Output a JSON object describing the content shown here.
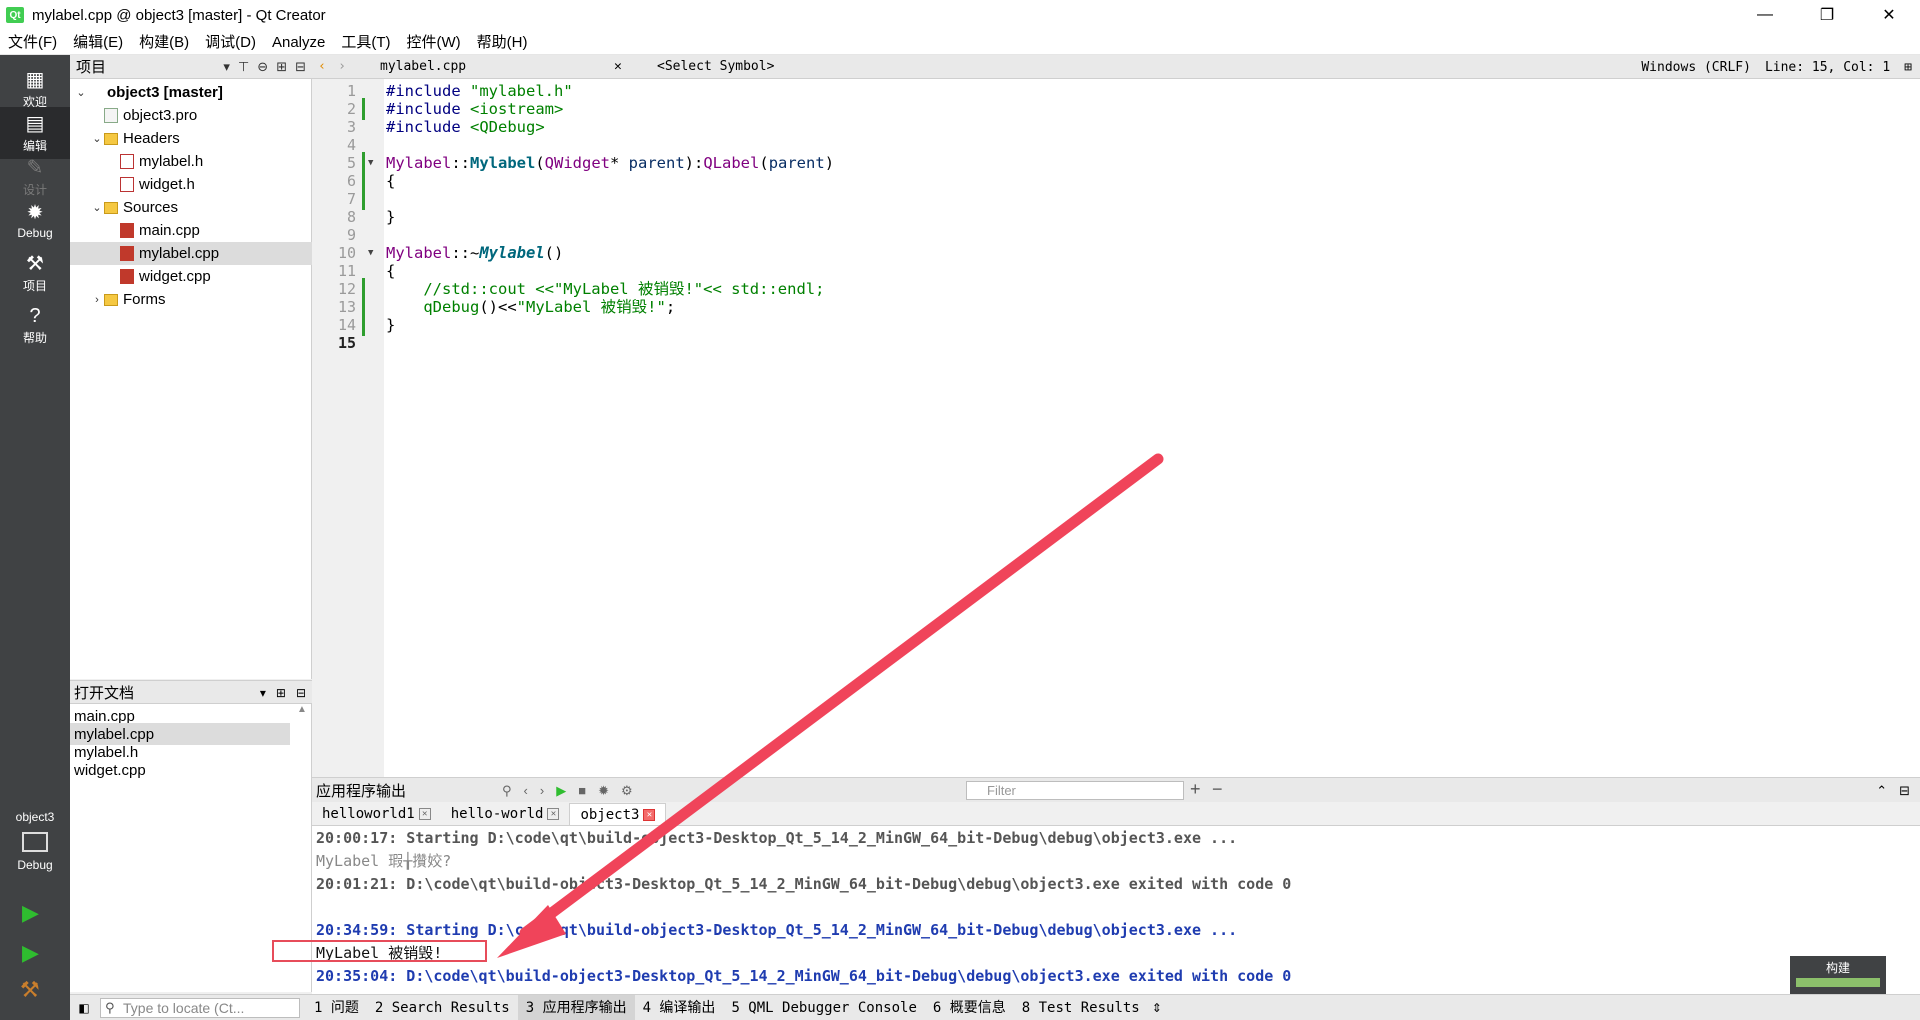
{
  "window": {
    "title": "mylabel.cpp @ object3 [master] - Qt Creator",
    "logo_text": "Qt",
    "minimize": "—",
    "maximize": "❐",
    "close": "✕"
  },
  "menu": [
    "文件(F)",
    "编辑(E)",
    "构建(B)",
    "调试(D)",
    "Analyze",
    "工具(T)",
    "控件(W)",
    "帮助(H)"
  ],
  "modes": [
    {
      "label": "欢迎",
      "icon": "grid-icon"
    },
    {
      "label": "编辑",
      "icon": "edit-icon"
    },
    {
      "label": "设计",
      "icon": "pencil-icon"
    },
    {
      "label": "Debug",
      "icon": "bug-icon"
    },
    {
      "label": "项目",
      "icon": "wrench-icon"
    },
    {
      "label": "帮助",
      "icon": "help-icon"
    }
  ],
  "kit": {
    "name": "object3",
    "mode": "Debug"
  },
  "project_panel": {
    "title": "项目",
    "tree": [
      {
        "label": "object3 [master]",
        "level": 0,
        "arrow": "open",
        "icon": "project",
        "bold": true
      },
      {
        "label": "object3.pro",
        "level": 1,
        "arrow": "",
        "icon": "pro"
      },
      {
        "label": "Headers",
        "level": 1,
        "arrow": "open",
        "icon": "folder"
      },
      {
        "label": "mylabel.h",
        "level": 2,
        "arrow": "",
        "icon": "header"
      },
      {
        "label": "widget.h",
        "level": 2,
        "arrow": "",
        "icon": "header"
      },
      {
        "label": "Sources",
        "level": 1,
        "arrow": "open",
        "icon": "folder"
      },
      {
        "label": "main.cpp",
        "level": 2,
        "arrow": "",
        "icon": "cpp"
      },
      {
        "label": "mylabel.cpp",
        "level": 2,
        "arrow": "",
        "icon": "cpp",
        "selected": true
      },
      {
        "label": "widget.cpp",
        "level": 2,
        "arrow": "",
        "icon": "cpp"
      },
      {
        "label": "Forms",
        "level": 1,
        "arrow": "closed",
        "icon": "folder"
      }
    ]
  },
  "open_documents": {
    "title": "打开文档",
    "items": [
      {
        "label": "main.cpp"
      },
      {
        "label": "mylabel.cpp",
        "selected": true
      },
      {
        "label": "mylabel.h"
      },
      {
        "label": "widget.cpp"
      }
    ]
  },
  "editor_toolbar": {
    "file": "mylabel.cpp",
    "symbol": "<Select Symbol>",
    "line_ending": "Windows (CRLF)",
    "position": "Line: 15, Col: 1"
  },
  "editor": {
    "current_line": 15,
    "lines": [
      "#include \"mylabel.h\"",
      "#include <iostream>",
      "#include <QDebug>",
      "",
      "Mylabel::Mylabel(QWidget* parent):QLabel(parent)",
      "{",
      "",
      "}",
      "",
      "Mylabel::~Mylabel()",
      "{",
      "    //std::cout <<\"MyLabel 被销毁!\"<< std::endl;",
      "    qDebug()<<\"MyLabel 被销毁!\";",
      "}",
      ""
    ]
  },
  "output": {
    "title": "应用程序输出",
    "filter_placeholder": "Filter",
    "tabs": [
      {
        "label": "helloworld1"
      },
      {
        "label": "hello-world"
      },
      {
        "label": "object3",
        "active": true
      }
    ],
    "lines": [
      {
        "text": "20:00:17: Starting D:\\code\\qt\\build-object3-Desktop_Qt_5_14_2_MinGW_64_bit-Debug\\debug\\object3.exe ...",
        "kind": "sys"
      },
      {
        "text": "MyLabel 瑕╁攢姣?",
        "kind": "msg"
      },
      {
        "text": "20:01:21: D:\\code\\qt\\build-object3-Desktop_Qt_5_14_2_MinGW_64_bit-Debug\\debug\\object3.exe exited with code 0",
        "kind": "sys"
      },
      {
        "text": "",
        "kind": "blank"
      },
      {
        "text": "20:34:59: Starting D:\\code\\qt\\build-object3-Desktop_Qt_5_14_2_MinGW_64_bit-Debug\\debug\\object3.exe ...",
        "kind": "sys2"
      },
      {
        "text": "MyLabel 被销毁!",
        "kind": "msg2"
      },
      {
        "text": "20:35:04: D:\\code\\qt\\build-object3-Desktop_Qt_5_14_2_MinGW_64_bit-Debug\\debug\\object3.exe exited with code 0",
        "kind": "sys2"
      }
    ]
  },
  "build": {
    "label": "构建",
    "progress": 1.0
  },
  "statusbar": {
    "locator_placeholder": "Type to locate (Ct...",
    "tabs": [
      {
        "label": "1 问题"
      },
      {
        "label": "2 Search Results"
      },
      {
        "label": "3 应用程序输出",
        "active": true
      },
      {
        "label": "4 编译输出"
      },
      {
        "label": "5 QML Debugger Console"
      },
      {
        "label": "6 概要信息"
      },
      {
        "label": "8 Test Results"
      }
    ]
  },
  "colors": {
    "annotation_arrow": "#f0445a",
    "mode_bar": "#404244",
    "run_green": "#2fbd2f"
  }
}
